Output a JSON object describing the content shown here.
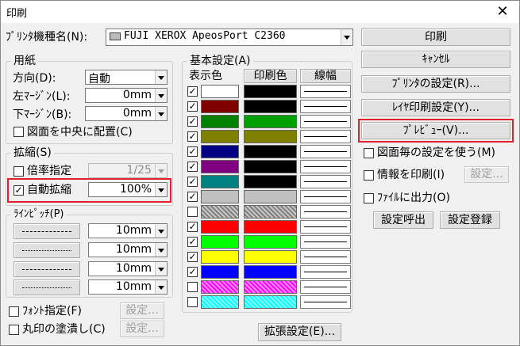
{
  "window": {
    "title": "印刷",
    "close_glyph": "✕"
  },
  "printer": {
    "label": "ﾌﾟﾘﾝﾀ機種名(N):",
    "value": "FUJI XEROX ApeosPort C2360",
    "icon": "printer-icon"
  },
  "paper": {
    "group_label": "用紙",
    "orientation_label": "方向(D):",
    "orientation_value": "自動",
    "left_margin_label": "左ﾏｰｼﾞﾝ(L):",
    "left_margin_value": "0mm",
    "bottom_margin_label": "下ﾏｰｼﾞﾝ(B):",
    "bottom_margin_value": "0mm",
    "center_label": "図面を中央に配置(C)",
    "center_checked": false
  },
  "scale": {
    "group_label": "拡縮(S)",
    "ratio_label": "倍率指定",
    "ratio_checked": false,
    "ratio_value": "1/25",
    "auto_label": "自動拡縮",
    "auto_checked": true,
    "auto_value": "100%"
  },
  "line_pitch": {
    "group_label": "ﾗｲﾝﾋﾟｯﾁ(P)",
    "rows": [
      {
        "value": "10mm"
      },
      {
        "value": "10mm"
      },
      {
        "value": "10mm"
      },
      {
        "value": "10mm"
      }
    ]
  },
  "font_spec": {
    "label": "ﾌｫﾝﾄ指定(F)",
    "checked": false,
    "btn": "設定..."
  },
  "circle_fill": {
    "label": "丸印の塗潰し(C)",
    "checked": false,
    "btn": "設定..."
  },
  "basic": {
    "group_label": "基本設定(A)",
    "col_display": "表示色",
    "col_print": "印刷色",
    "col_width": "線幅",
    "rows": [
      {
        "checked": true,
        "display": "#ffffff",
        "print": "#000000",
        "hatch": false
      },
      {
        "checked": true,
        "display": "#800000",
        "print": "#000000",
        "hatch": false
      },
      {
        "checked": true,
        "display": "#008000",
        "print": "#00a000",
        "hatch": false
      },
      {
        "checked": true,
        "display": "#808000",
        "print": "#808000",
        "hatch": false
      },
      {
        "checked": true,
        "display": "#000080",
        "print": "#000000",
        "hatch": false
      },
      {
        "checked": true,
        "display": "#800080",
        "print": "#000000",
        "hatch": false
      },
      {
        "checked": true,
        "display": "#008080",
        "print": "#000000",
        "hatch": false
      },
      {
        "checked": true,
        "display": "#c0c0c0",
        "print": "#c0c0c0",
        "hatch": false
      },
      {
        "checked": false,
        "display": "#808080",
        "print": "#808080",
        "hatch": true
      },
      {
        "checked": true,
        "display": "#ff0000",
        "print": "#ff0000",
        "hatch": false
      },
      {
        "checked": true,
        "display": "#00ff00",
        "print": "#00ff00",
        "hatch": false
      },
      {
        "checked": true,
        "display": "#ffff00",
        "print": "#ffff00",
        "hatch": false
      },
      {
        "checked": true,
        "display": "#0000ff",
        "print": "#0000ff",
        "hatch": false
      },
      {
        "checked": false,
        "display": "#ff00ff",
        "print": "#ff00ff",
        "hatch": true
      },
      {
        "checked": false,
        "display": "#00ffff",
        "print": "#00ffff",
        "hatch": true
      }
    ]
  },
  "extended_btn": "拡張設定(E)...",
  "right": {
    "print_btn": "印刷",
    "cancel_btn": "ｷｬﾝｾﾙ",
    "printer_settings_btn": "ﾌﾟﾘﾝﾀの設定(R)...",
    "layer_btn": "ﾚｲﾔ印刷設定(Y)...",
    "preview_btn": "ﾌﾟﾚﾋﾞｭｰ(V)...",
    "per_drawing_label": "図面毎の設定を使う(M)",
    "per_drawing_checked": false,
    "info_label": "情報を印刷(I)",
    "info_checked": false,
    "info_btn": "設定...",
    "file_out_label": "ﾌｧｲﾙに出力(O)",
    "file_out_checked": false,
    "call_btn": "設定呼出",
    "register_btn": "設定登録"
  },
  "highlight_color": "#e0202c"
}
